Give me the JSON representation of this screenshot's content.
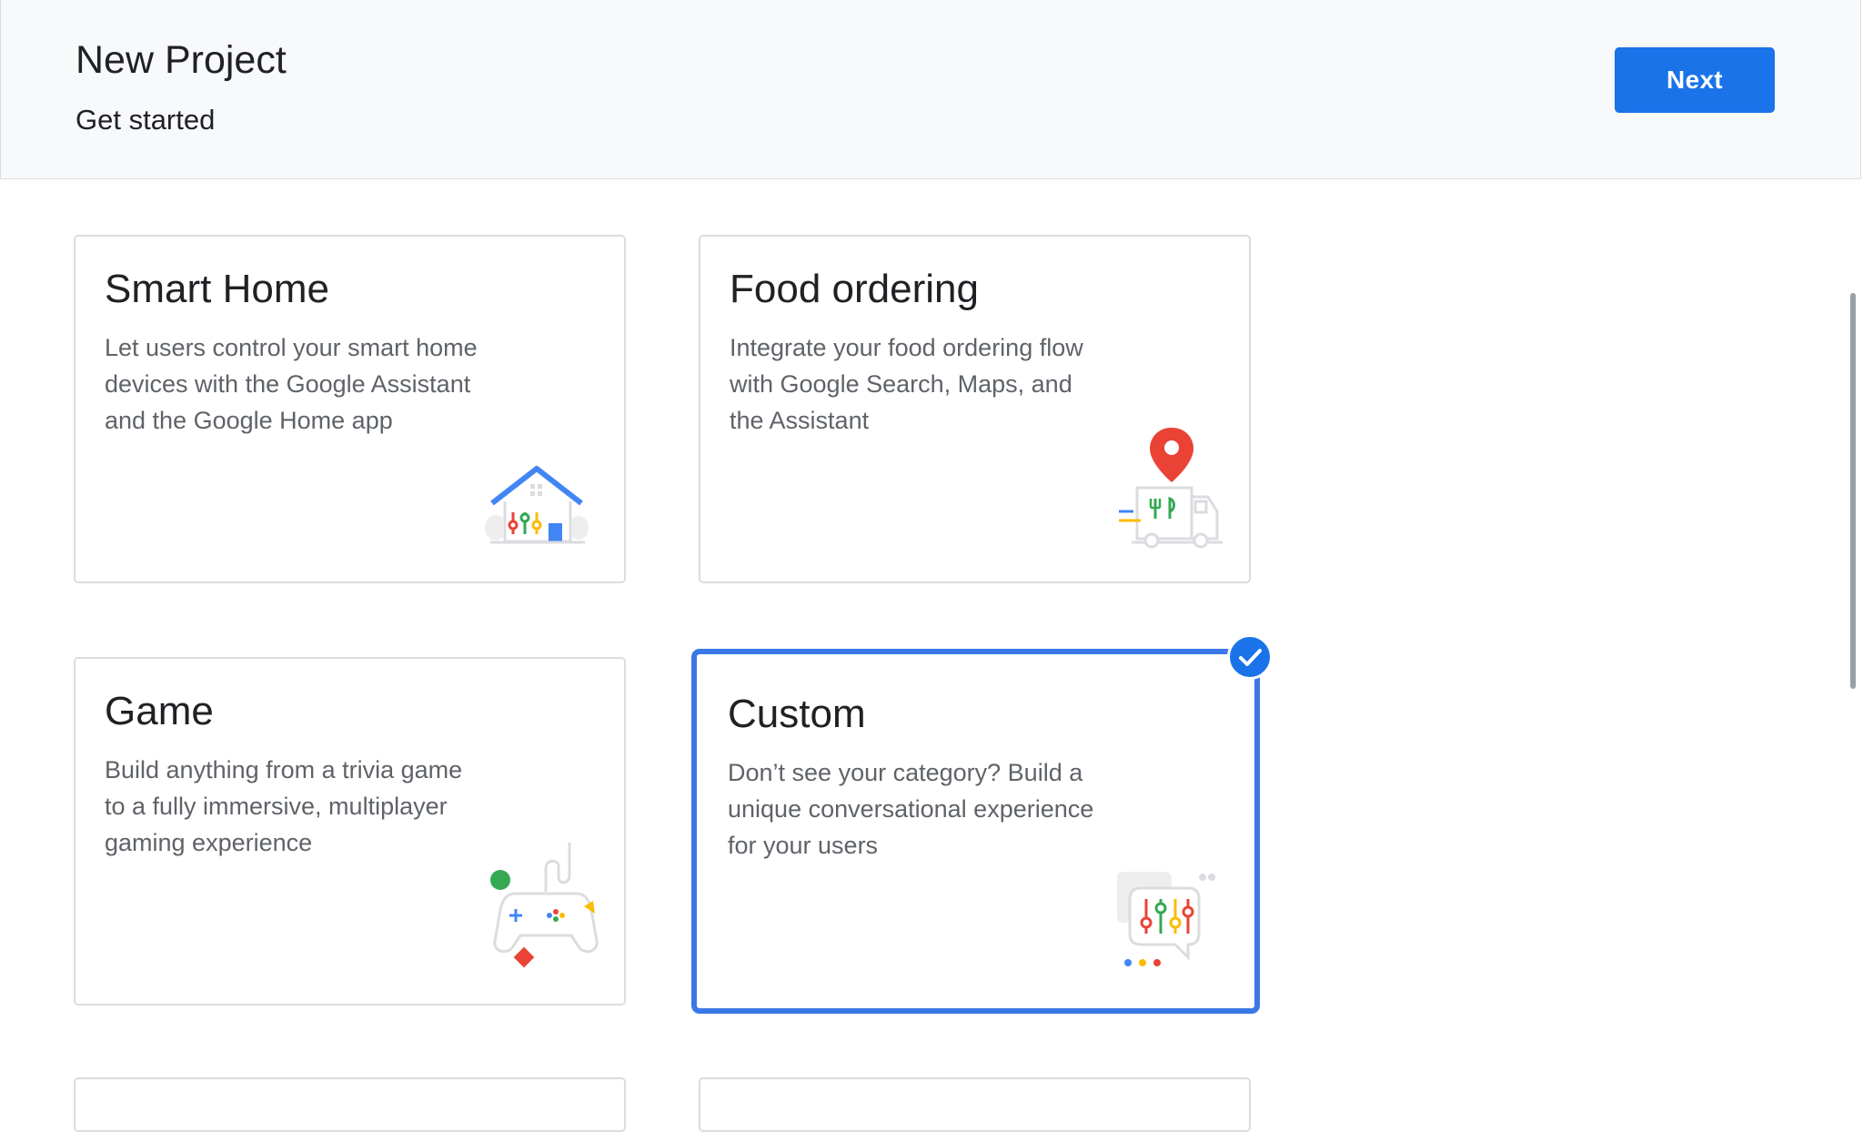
{
  "header": {
    "title": "New Project",
    "subtitle": "Get started",
    "next_label": "Next"
  },
  "cards": [
    {
      "title": "Smart Home",
      "description": "Let users control your smart home devices with the Google Assistant and the Google Home app",
      "icon": "smart-home-icon",
      "selected": false
    },
    {
      "title": "Food ordering",
      "description": "Integrate your food ordering flow with Google Search, Maps, and the Assistant",
      "icon": "food-truck-icon",
      "selected": false
    },
    {
      "title": "Game",
      "description": "Build anything from a trivia game to a fully immersive, multiplayer gaming experience",
      "icon": "game-controller-icon",
      "selected": false
    },
    {
      "title": "Custom",
      "description": "Don’t see your category? Build a unique conversational experience for your users",
      "icon": "custom-chat-icon",
      "selected": true
    }
  ],
  "colors": {
    "accent": "#1a73e8",
    "selected_border": "#3b78e7",
    "google_blue": "#4285f4",
    "google_red": "#ea4335",
    "google_yellow": "#fbbc04",
    "google_green": "#34a853"
  }
}
